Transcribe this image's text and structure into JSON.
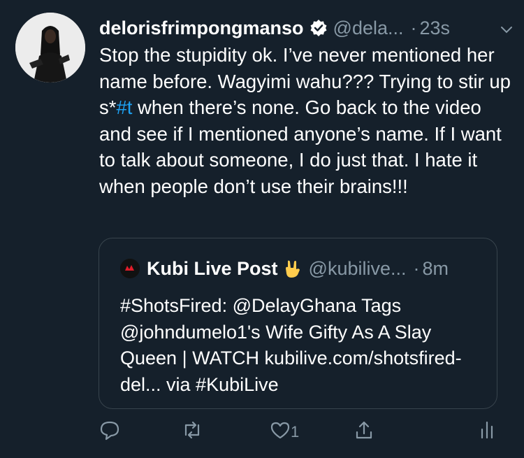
{
  "tweet": {
    "name": "delorisfrimpongmanso",
    "handle": "@dela...",
    "separator": "·",
    "time": "23s",
    "text_before_link": "Stop the stupidity ok. I’ve never mentioned her name before. Wagyimi wahu??? Trying to stir up s*",
    "link": "#t",
    "text_after_link": " when there’s none. Go back to the video and see if I mentioned anyone’s name. If I want to talk about someone, I do just that. I hate it when people don’t use their brains!!!"
  },
  "quoted": {
    "name": "Kubi Live Post",
    "handle": "@kubilive...",
    "separator": "·",
    "time": "8m",
    "text": "#ShotsFired: @DelayGhana Tags @johndumelo1's Wife Gifty As A Slay Queen | WATCH kubilive.com/shotsfired-del... via #KubiLive"
  },
  "actions": {
    "like_count": "1"
  },
  "colors": {
    "background": "#15202b",
    "secondary_text": "#8899a6",
    "link": "#1da1f2",
    "border": "#38444d"
  }
}
